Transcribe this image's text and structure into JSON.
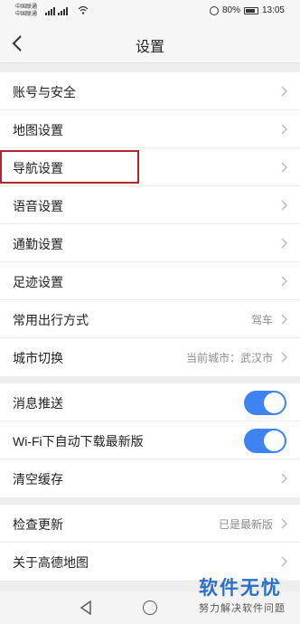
{
  "status_bar": {
    "carrier_1": "中国联通",
    "carrier_2": "中国联通",
    "battery": "80%",
    "time": "13:05",
    "icons": [
      "signal-icon",
      "wifi-icon",
      "alarm-icon",
      "battery-icon"
    ]
  },
  "header": {
    "title": "设置",
    "back_icon": "chevron-left-icon"
  },
  "groups": [
    {
      "items": [
        {
          "label": "账号与安全",
          "value": ""
        },
        {
          "label": "地图设置",
          "value": ""
        },
        {
          "label": "导航设置",
          "value": ""
        },
        {
          "label": "语音设置",
          "value": ""
        },
        {
          "label": "通勤设置",
          "value": ""
        },
        {
          "label": "足迹设置",
          "value": ""
        },
        {
          "label": "常用出行方式",
          "value": "驾车"
        },
        {
          "label": "城市切换",
          "value": "当前城市：武汉市"
        }
      ]
    },
    {
      "items": [
        {
          "label": "消息推送",
          "toggle": true
        },
        {
          "label": "Wi-Fi下自动下载最新版",
          "toggle": true
        },
        {
          "label": "清空缓存",
          "value": ""
        }
      ]
    },
    {
      "items": [
        {
          "label": "检查更新",
          "value": "已是最新版"
        },
        {
          "label": "关于高德地图",
          "value": ""
        }
      ]
    }
  ],
  "watermark": {
    "title": "软件无忧",
    "subtitle": "努力解决软件问题"
  },
  "colors": {
    "toggle_on": "#3f82f2",
    "highlight_box": "#b0282e",
    "watermark": "#2a6fc9"
  }
}
